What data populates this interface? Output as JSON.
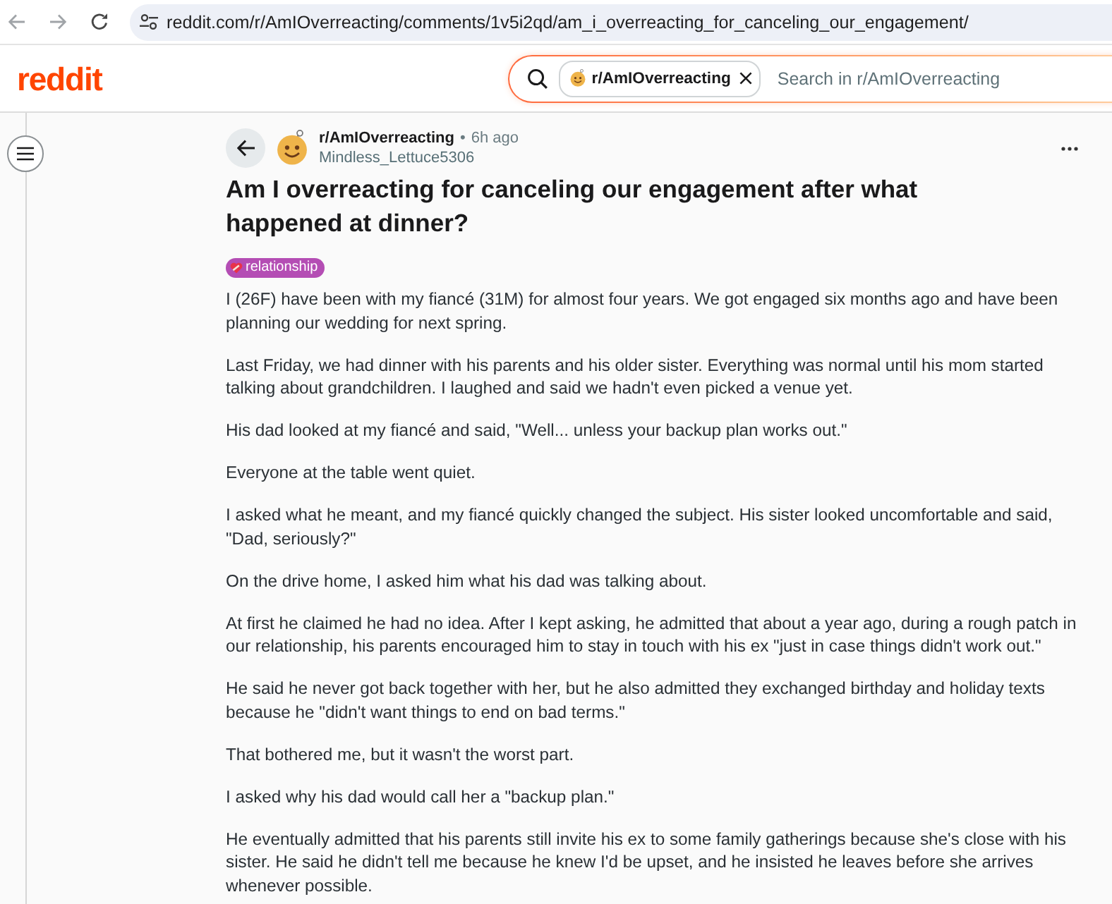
{
  "browser": {
    "url": "reddit.com/r/AmIOverreacting/comments/1v5i2qd/am_i_overreacting_for_canceling_our_engagement/"
  },
  "header": {
    "logo": "reddit",
    "search": {
      "community": "r/AmIOverreacting",
      "placeholder": "Search in r/AmIOverreacting"
    }
  },
  "post": {
    "subreddit": "r/AmIOverreacting",
    "separator": "•",
    "time": "6h ago",
    "author": "Mindless_Lettuce5306",
    "title": "Am I overreacting for canceling our engagement after what happened at dinner?",
    "flair": "relationship",
    "body": [
      "I (26F) have been with my fiancé (31M) for almost four years. We got engaged six months ago and have been planning our wedding for next spring.",
      "Last Friday, we had dinner with his parents and his older sister. Everything was normal until his mom started talking about grandchildren. I laughed and said we hadn't even picked a venue yet.",
      "His dad looked at my fiancé and said, \"Well... unless your backup plan works out.\"",
      "Everyone at the table went quiet.",
      "I asked what he meant, and my fiancé quickly changed the subject. His sister looked uncomfortable and said, \"Dad, seriously?\"",
      "On the drive home, I asked him what his dad was talking about.",
      "At first he claimed he had no idea. After I kept asking, he admitted that about a year ago, during a rough patch in our relationship, his parents encouraged him to stay in touch with his ex \"just in case things didn't work out.\"",
      "He said he never got back together with her, but he also admitted they exchanged birthday and holiday texts because he \"didn't want things to end on bad terms.\"",
      "That bothered me, but it wasn't the worst part.",
      "I asked why his dad would call her a \"backup plan.\"",
      "He eventually admitted that his parents still invite his ex to some family gatherings because she's close with his sister. He said he didn't tell me because he knew I'd be upset, and he insisted he leaves before she arrives whenever possible."
    ]
  }
}
